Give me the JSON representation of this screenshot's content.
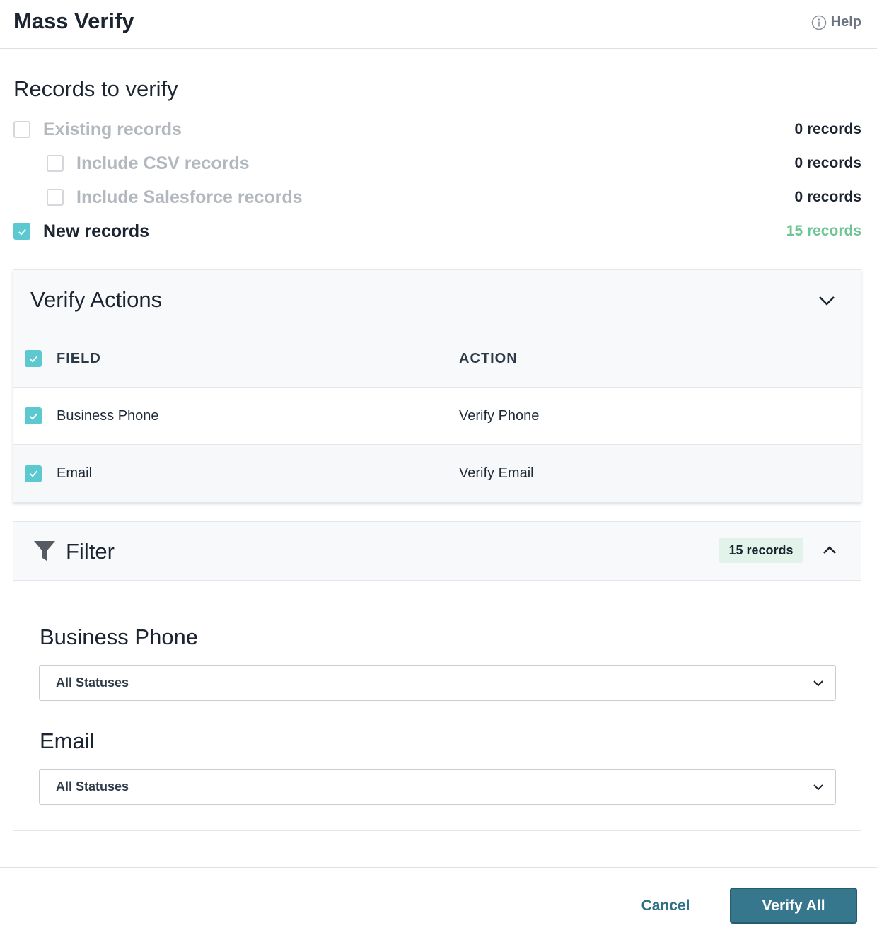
{
  "header": {
    "title": "Mass Verify",
    "help_label": "Help"
  },
  "records_section": {
    "title": "Records to verify",
    "items": [
      {
        "label": "Existing records",
        "count": "0 records",
        "checked": false
      },
      {
        "label": "Include CSV records",
        "count": "0 records",
        "checked": false
      },
      {
        "label": "Include Salesforce records",
        "count": "0 records",
        "checked": false
      },
      {
        "label": "New records",
        "count": "15 records",
        "checked": true
      }
    ]
  },
  "verify_actions": {
    "title": "Verify Actions",
    "columns": {
      "field": "FIELD",
      "action": "ACTION"
    },
    "rows": [
      {
        "field": "Business Phone",
        "action": "Verify Phone",
        "checked": true
      },
      {
        "field": "Email",
        "action": "Verify Email",
        "checked": true
      }
    ]
  },
  "filter": {
    "title": "Filter",
    "badge": "15 records",
    "fields": [
      {
        "label": "Business Phone",
        "selected": "All Statuses"
      },
      {
        "label": "Email",
        "selected": "All Statuses"
      }
    ]
  },
  "footer": {
    "cancel_label": "Cancel",
    "verify_label": "Verify All"
  },
  "colors": {
    "accent": "#5cc8d0",
    "primary_button": "#36778d",
    "success_text": "#6cc593",
    "badge_bg": "#e2f4ea"
  },
  "icons": [
    "info-icon",
    "check-icon",
    "chevron-down-icon",
    "chevron-up-icon",
    "funnel-icon"
  ]
}
